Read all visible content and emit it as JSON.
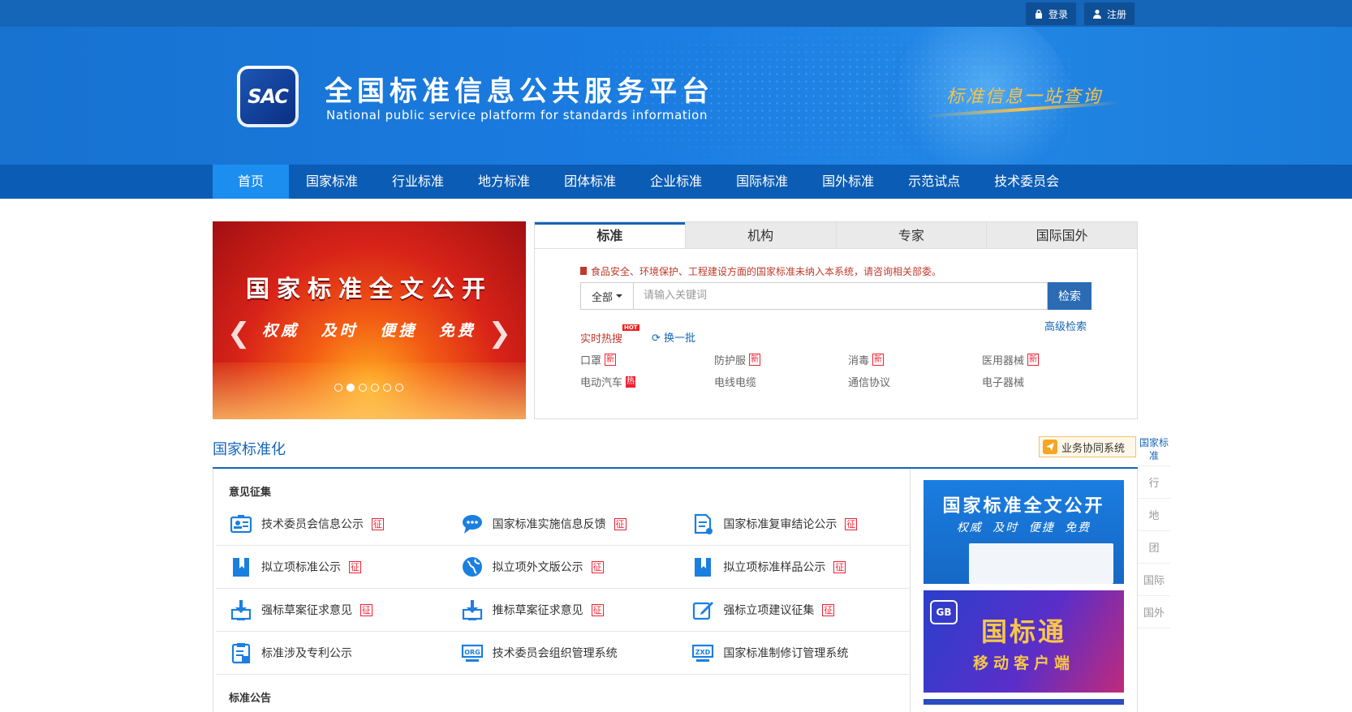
{
  "topbar": {
    "login": "登录",
    "register": "注册"
  },
  "banner": {
    "logo_text": "SAC",
    "title": "全国标准信息公共服务平台",
    "subtitle": "National public service platform  for standards information",
    "slogan": "标准信息一站查询"
  },
  "nav": [
    "首页",
    "国家标准",
    "行业标准",
    "地方标准",
    "团体标准",
    "企业标准",
    "国际标准",
    "国外标准",
    "示范试点",
    "技术委员会"
  ],
  "carousel": {
    "caption": "国家标准全文公开",
    "tagline": "权威 及时 便捷 免费",
    "prev": "❮",
    "next": "❯",
    "slide_count": 6,
    "active_slide": 2
  },
  "search": {
    "tabs": [
      "标准",
      "机构",
      "专家",
      "国际国外"
    ],
    "notice": "食品安全、环境保护、工程建设方面的国家标准未纳入本系统，请咨询相关部委。",
    "scope": "全部",
    "placeholder": "请输入关键词",
    "button": "检索",
    "advanced": "高级检索",
    "hot_label": "实时热搜",
    "hot_badge": "HOT",
    "refresh": "换一批",
    "hot_items": [
      {
        "text": "口罩",
        "tag": "新",
        "tag_type": "new"
      },
      {
        "text": "防护服",
        "tag": "新",
        "tag_type": "new"
      },
      {
        "text": "消毒",
        "tag": "新",
        "tag_type": "new"
      },
      {
        "text": "医用器械",
        "tag": "新",
        "tag_type": "new"
      },
      {
        "text": "电动汽车",
        "tag": "热",
        "tag_type": "hot"
      },
      {
        "text": "电线电缆",
        "tag": "",
        "tag_type": ""
      },
      {
        "text": "通信协议",
        "tag": "",
        "tag_type": ""
      },
      {
        "text": "电子器械",
        "tag": "",
        "tag_type": ""
      }
    ]
  },
  "section": {
    "title": "国家标准化",
    "collab_button": "业务协同系统",
    "group1": "意见征集",
    "group2": "标准公告",
    "items": [
      {
        "text": "技术委员会信息公示",
        "tag": "征",
        "icon": "id-card-icon"
      },
      {
        "text": "国家标准实施信息反馈",
        "tag": "征",
        "icon": "chat-bubble-icon"
      },
      {
        "text": "国家标准复审结论公示",
        "tag": "征",
        "icon": "document-edit-icon"
      },
      {
        "text": "拟立项标准公示",
        "tag": "征",
        "icon": "bookmark-icon"
      },
      {
        "text": "拟立项外文版公示",
        "tag": "征",
        "icon": "globe-icon"
      },
      {
        "text": "拟立项标准样品公示",
        "tag": "征",
        "icon": "bookmark-icon"
      },
      {
        "text": "强标草案征求意见",
        "tag": "征",
        "icon": "download-monitor-icon"
      },
      {
        "text": "推标草案征求意见",
        "tag": "征",
        "icon": "download-monitor-icon"
      },
      {
        "text": "强标立项建议征集",
        "tag": "征",
        "icon": "edit-icon"
      },
      {
        "text": "标准涉及专利公示",
        "tag": "",
        "icon": "clipboard-icon"
      },
      {
        "text": "技术委员会组织管理系统",
        "tag": "",
        "icon": "org-icon"
      },
      {
        "text": "国家标准制修订管理系统",
        "tag": "",
        "icon": "zxd-icon"
      }
    ]
  },
  "promos": {
    "p1_title": "国家标准全文公开",
    "p1_tagline": "权威 及时 便捷 免费",
    "p2_logo": "GB",
    "p2_title": "国标通",
    "p2_sub": "移动客户端"
  },
  "side_index": [
    "国家标准",
    "行",
    "地",
    "团",
    "国际",
    "国外"
  ],
  "colors": {
    "primary": "#1565b8",
    "nav_active": "#1b8ef0",
    "alert": "#e22222",
    "accent_gold": "#f7c14a"
  }
}
